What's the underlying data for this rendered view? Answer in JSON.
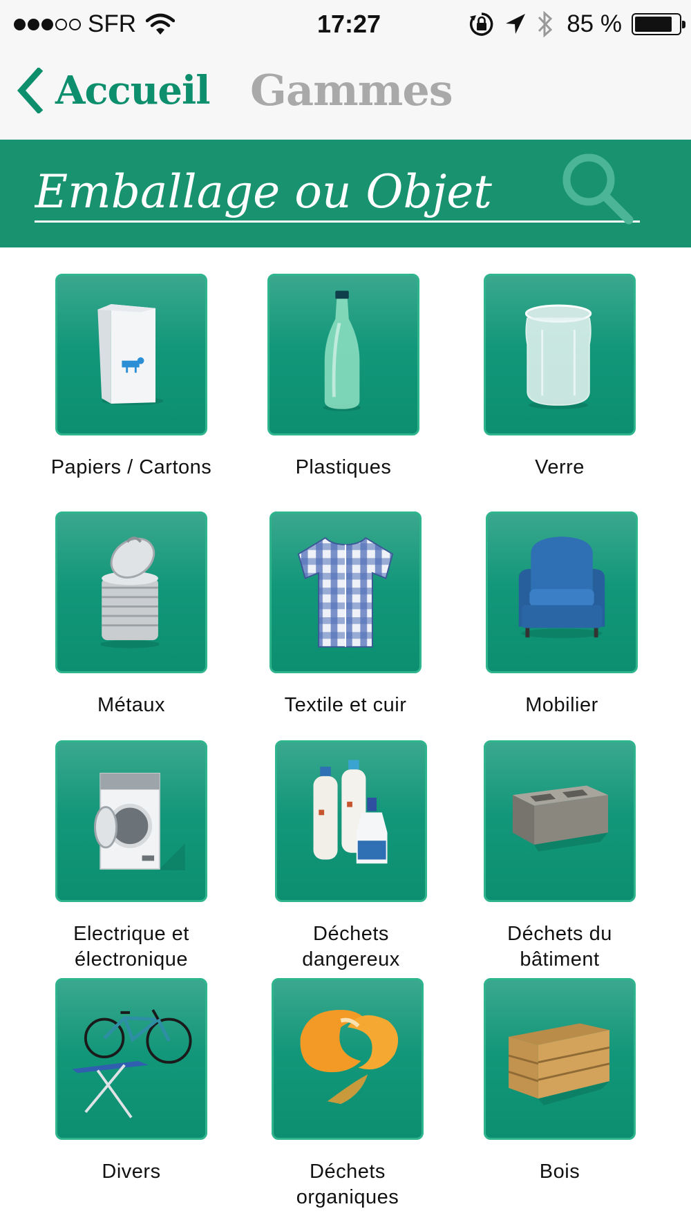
{
  "status_bar": {
    "carrier": "SFR",
    "time": "17:27",
    "battery_percent": "85 %",
    "battery_level": 0.85,
    "signal_bars_filled": 3,
    "signal_bars_total": 5,
    "icons": [
      "wifi-icon",
      "rotation-lock-icon",
      "location-icon",
      "bluetooth-icon",
      "battery-icon"
    ]
  },
  "nav": {
    "back_label": "Accueil",
    "title": "Gammes"
  },
  "search": {
    "placeholder": "Emballage ou Objet",
    "value": ""
  },
  "colors": {
    "brand_green": "#19936f",
    "accent_green": "#0d8f6e",
    "tile_border": "#2fb58d",
    "title_grey": "#a9a9a9"
  },
  "categories": [
    {
      "label": "Papiers / Cartons",
      "icon": "milk-carton-icon"
    },
    {
      "label": "Plastiques",
      "icon": "plastic-bottle-icon"
    },
    {
      "label": "Verre",
      "icon": "glass-jar-icon"
    },
    {
      "label": "Métaux",
      "icon": "tin-can-icon"
    },
    {
      "label": "Textile et cuir",
      "icon": "shirt-icon"
    },
    {
      "label": "Mobilier",
      "icon": "armchair-icon"
    },
    {
      "label": "Electrique et\nélectronique",
      "icon": "washing-machine-icon"
    },
    {
      "label": "Déchets\ndangereux",
      "icon": "chemical-bottles-icon"
    },
    {
      "label": "Déchets du\nbâtiment",
      "icon": "cinder-block-icon"
    },
    {
      "label": "Divers",
      "icon": "bicycle-ironing-board-icon"
    },
    {
      "label": "Déchets\norganiques",
      "icon": "orange-peel-icon"
    },
    {
      "label": "Bois",
      "icon": "wooden-crate-icon"
    }
  ]
}
